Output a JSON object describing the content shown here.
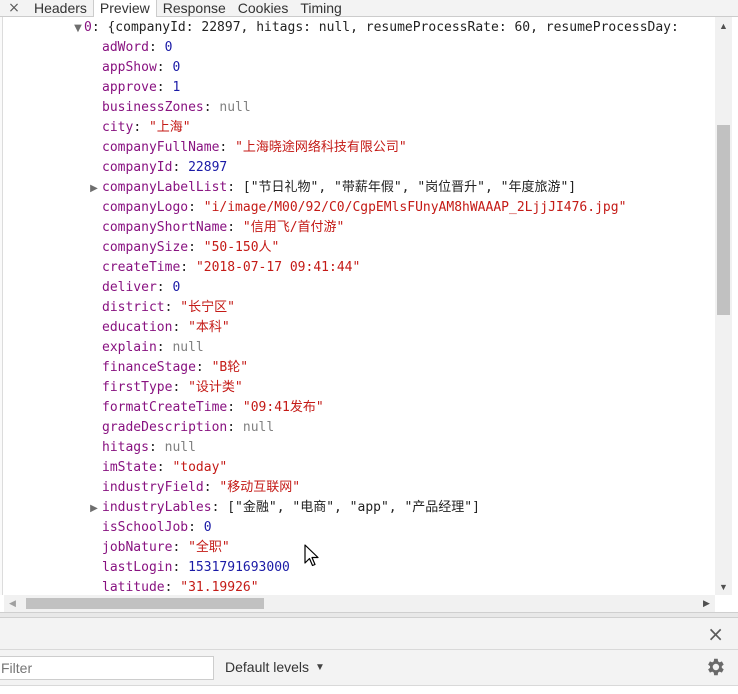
{
  "tabs": {
    "close_glyph": "×",
    "items": [
      "Headers",
      "Preview",
      "Response",
      "Cookies",
      "Timing"
    ],
    "active": "Preview"
  },
  "preview": {
    "root": {
      "index": "0",
      "summary": "{companyId: 22897, hitags: null, resumeProcessRate: 60, resumeProcessDay:"
    },
    "entries": [
      {
        "key": "adWord",
        "value": "0",
        "type": "num"
      },
      {
        "key": "appShow",
        "value": "0",
        "type": "num"
      },
      {
        "key": "approve",
        "value": "1",
        "type": "num"
      },
      {
        "key": "businessZones",
        "value": "null",
        "type": "nul"
      },
      {
        "key": "city",
        "value": "\"上海\"",
        "type": "str"
      },
      {
        "key": "companyFullName",
        "value": "\"上海晓途网络科技有限公司\"",
        "type": "str"
      },
      {
        "key": "companyId",
        "value": "22897",
        "type": "num"
      },
      {
        "key": "companyLabelList",
        "value": "[\"节日礼物\", \"带薪年假\", \"岗位晋升\", \"年度旅游\"]",
        "type": "plain",
        "expandable": true
      },
      {
        "key": "companyLogo",
        "value": "\"i/image/M00/92/C0/CgpEMlsFUnyAM8hWAAAP_2LjjJI476.jpg\"",
        "type": "str"
      },
      {
        "key": "companyShortName",
        "value": "\"信用飞/首付游\"",
        "type": "str"
      },
      {
        "key": "companySize",
        "value": "\"50-150人\"",
        "type": "str"
      },
      {
        "key": "createTime",
        "value": "\"2018-07-17 09:41:44\"",
        "type": "str"
      },
      {
        "key": "deliver",
        "value": "0",
        "type": "num"
      },
      {
        "key": "district",
        "value": "\"长宁区\"",
        "type": "str"
      },
      {
        "key": "education",
        "value": "\"本科\"",
        "type": "str"
      },
      {
        "key": "explain",
        "value": "null",
        "type": "nul"
      },
      {
        "key": "financeStage",
        "value": "\"B轮\"",
        "type": "str"
      },
      {
        "key": "firstType",
        "value": "\"设计类\"",
        "type": "str"
      },
      {
        "key": "formatCreateTime",
        "value": "\"09:41发布\"",
        "type": "str"
      },
      {
        "key": "gradeDescription",
        "value": "null",
        "type": "nul"
      },
      {
        "key": "hitags",
        "value": "null",
        "type": "nul"
      },
      {
        "key": "imState",
        "value": "\"today\"",
        "type": "str"
      },
      {
        "key": "industryField",
        "value": "\"移动互联网\"",
        "type": "str"
      },
      {
        "key": "industryLables",
        "value": "[\"金融\", \"电商\", \"app\", \"产品经理\"]",
        "type": "plain",
        "expandable": true
      },
      {
        "key": "isSchoolJob",
        "value": "0",
        "type": "num"
      },
      {
        "key": "jobNature",
        "value": "\"全职\"",
        "type": "str"
      },
      {
        "key": "lastLogin",
        "value": "1531791693000",
        "type": "num"
      },
      {
        "key": "latitude",
        "value": "\"31.19926\"",
        "type": "str"
      }
    ]
  },
  "drawer": {
    "close_glyph": "×",
    "filter_placeholder": "Filter",
    "levels_label": "Default levels",
    "levels_caret": "▼"
  },
  "colors": {
    "key": "#881280",
    "string": "#c41a16",
    "number": "#1a1aa6",
    "null": "#808080"
  }
}
